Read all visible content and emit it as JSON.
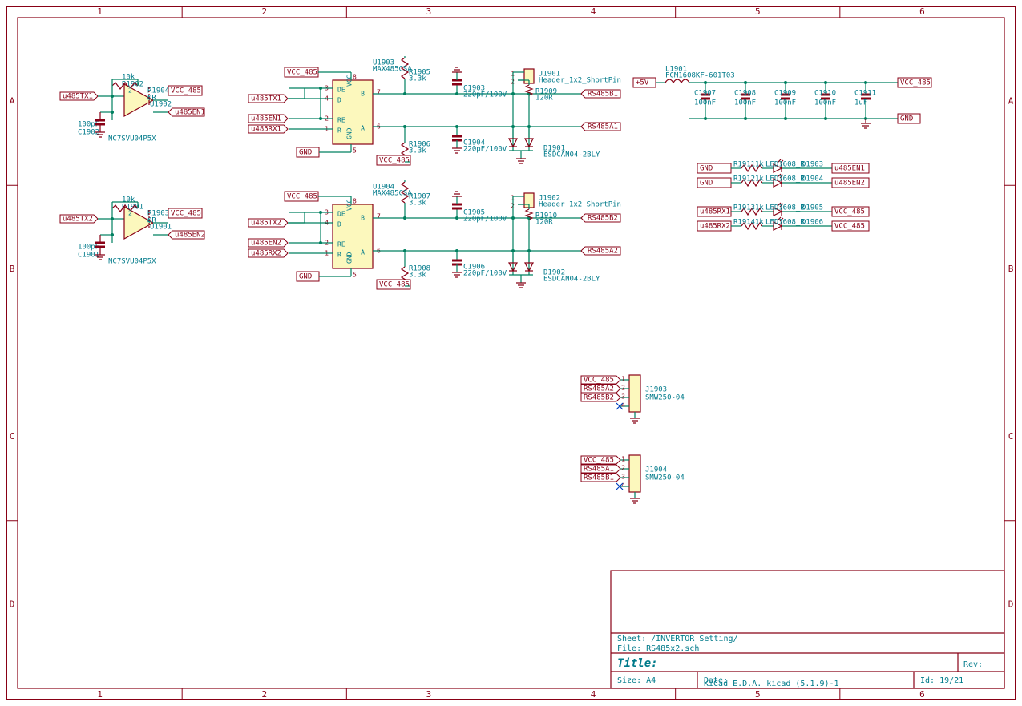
{
  "ruler": {
    "cols": [
      "1",
      "2",
      "3",
      "4",
      "5",
      "6"
    ],
    "rows": [
      "A",
      "B",
      "C",
      "D"
    ]
  },
  "title_block": {
    "sheet": "Sheet: /INVERTOR Setting/",
    "file": "File: RS485x2.sch",
    "title_hdr": "Title:",
    "size": "Size: A4",
    "date": "Date:",
    "rev": "Rev:",
    "kicad": "KiCad E.D.A.  kicad (5.1.9)-1",
    "id": "Id: 19/21"
  },
  "block1": {
    "net_tx": "u485TX1",
    "net_en": "u485EN1",
    "vcc": "VCC_485",
    "r_ref": "R1902",
    "r_val": "10k",
    "r2_ref": "R1904",
    "r2_val": "0R",
    "c_ref": "C1902",
    "c_val": "100pF",
    "u_ref": "U1902",
    "u_val": "NC7SVU04P5X"
  },
  "block2": {
    "net_tx": "u485TX2",
    "net_en": "u485EN2",
    "vcc": "VCC_485",
    "r_ref": "R1901",
    "r_val": "10k",
    "r2_ref": "R1903",
    "r2_val": "0R",
    "c_ref": "C1901",
    "c_val": "100pF",
    "u_ref": "U1901",
    "u_val": "NC7SVU04P5X"
  },
  "ic1": {
    "ref": "U1903",
    "val": "MAX485CSA",
    "vcc_t": "VCC_485",
    "gnd": "GND",
    "vcc_b": "VCC_485",
    "nets": {
      "tx": "u485TX1",
      "en": "u485EN1",
      "rx": "u485RX1"
    },
    "rt": {
      "ref": "R1905",
      "val": "3.3k"
    },
    "rb": {
      "ref": "R1906",
      "val": "3.3k"
    },
    "ct": {
      "ref": "C1903",
      "val": "220pF/100V"
    },
    "cb": {
      "ref": "C1904",
      "val": "220pF/100V"
    },
    "j": {
      "ref": "J1901",
      "val": "Header_1x2_ShortPin"
    },
    "rterm": {
      "ref": "R1909",
      "val": "120R"
    },
    "d": {
      "ref": "D1901",
      "val": "ESDCAN04-2BLY"
    },
    "out_b": "RS485B1",
    "out_a": "RS485A1"
  },
  "ic2": {
    "ref": "U1904",
    "val": "MAX485CSA",
    "vcc_t": "VCC_485",
    "gnd": "GND",
    "vcc_b": "VCC_485",
    "nets": {
      "tx": "u485TX2",
      "en": "u485EN2",
      "rx": "u485RX2"
    },
    "rt": {
      "ref": "R1907",
      "val": "3.3k"
    },
    "rb": {
      "ref": "R1908",
      "val": "3.3k"
    },
    "ct": {
      "ref": "C1905",
      "val": "220pF/100V"
    },
    "cb": {
      "ref": "C1906",
      "val": "220pF/100V"
    },
    "j": {
      "ref": "J1902",
      "val": "Header_1x2_ShortPin"
    },
    "rterm": {
      "ref": "R1910",
      "val": "120R"
    },
    "d": {
      "ref": "D1902",
      "val": "ESDCAN04-2BLY"
    },
    "out_b": "RS485B2",
    "out_a": "RS485A2"
  },
  "filter": {
    "in": "+5V",
    "l": {
      "ref": "L1901",
      "val": "FCM1608KF-601T03"
    },
    "out_vcc": "VCC_485",
    "out_gnd": "GND",
    "caps": [
      {
        "ref": "C1907",
        "val": "100nF"
      },
      {
        "ref": "C1908",
        "val": "100nF"
      },
      {
        "ref": "C1909",
        "val": "100nF"
      },
      {
        "ref": "C1910",
        "val": "100nF"
      },
      {
        "ref": "C1911",
        "val": "1uF"
      }
    ]
  },
  "leds": [
    {
      "left": "GND",
      "r": "R1911",
      "rv": "1k",
      "led": "LED1608_R",
      "d": "D1903",
      "right": "u485EN1"
    },
    {
      "left": "GND",
      "r": "R1912",
      "rv": "1k",
      "led": "LED1608_R",
      "d": "D1904",
      "right": "u485EN2"
    },
    {
      "left": "u485RX1",
      "r": "R1913",
      "rv": "1k",
      "led": "LED1608_R",
      "d": "D1905",
      "right": "VCC_485"
    },
    {
      "left": "u485RX2",
      "r": "R1914",
      "rv": "1k",
      "led": "LED1608_R",
      "d": "D1906",
      "right": "VCC_485"
    }
  ],
  "conn1": {
    "ref": "J1903",
    "val": "SMW250-04",
    "pins": [
      "VCC_485",
      "RS485A2",
      "RS485B2"
    ]
  },
  "conn2": {
    "ref": "J1904",
    "val": "SMW250-04",
    "pins": [
      "VCC_485",
      "RS485A1",
      "RS485B1"
    ]
  }
}
